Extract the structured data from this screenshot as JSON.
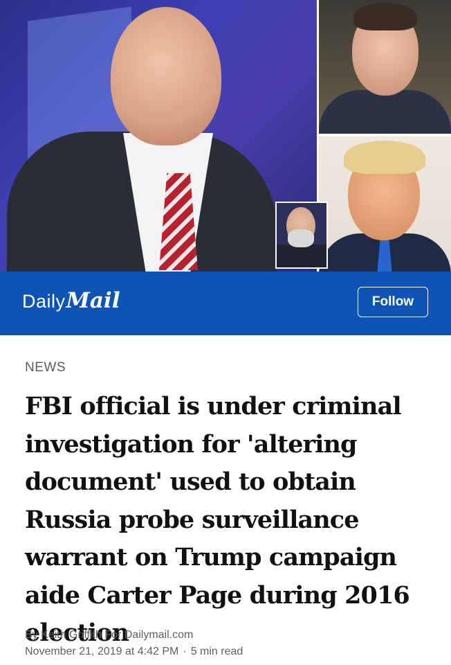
{
  "brand": {
    "daily": "Daily",
    "mail": "Mail",
    "bar_color": "#0e54b7"
  },
  "follow_button": {
    "label": "Follow"
  },
  "article": {
    "category": "NEWS",
    "headline": "FBI official is under criminal investigation for 'altering document' used to obtain Russia probe surveillance warrant on Trump campaign aide Carter Page during 2016 election",
    "byline": "By Keith Griffith For Dailymail.com",
    "date": "November 21, 2019 at 4:42 PM",
    "separator": "·",
    "read_time": "5 min read"
  },
  "images": {
    "main": "photo-of-man-in-suit-speaking",
    "inset": "photo-of-bearded-man-with-glasses",
    "top_right": "photo-of-man-in-suit",
    "bottom_right": "photo-of-man-with-blue-tie"
  }
}
